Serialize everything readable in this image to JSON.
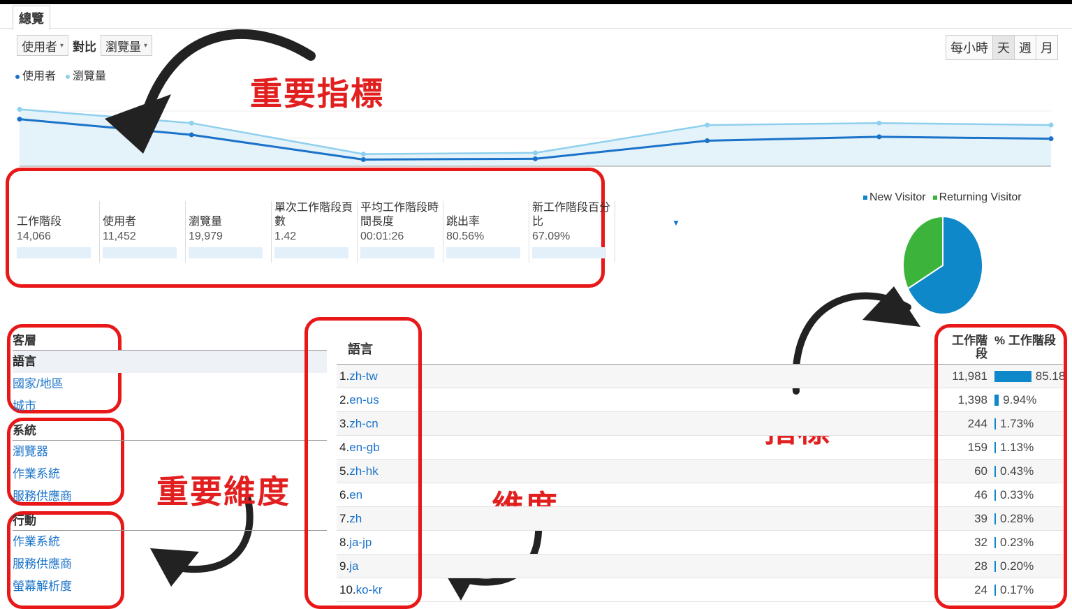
{
  "tab": "總覽",
  "controls": {
    "metric_a": "使用者",
    "versus": "對比",
    "metric_b": "瀏覽量"
  },
  "period": [
    "每小時",
    "天",
    "週",
    "月"
  ],
  "chart_legend": [
    {
      "label": "使用者",
      "color": "#1a73c9"
    },
    {
      "label": "瀏覽量",
      "color": "#8fd0ee"
    }
  ],
  "chart_data": {
    "type": "line",
    "x": [
      1,
      2,
      3,
      4,
      5,
      6,
      7
    ],
    "series": [
      {
        "name": "使用者",
        "values": [
          2400,
          1600,
          340,
          380,
          1300,
          1500,
          1400
        ]
      },
      {
        "name": "瀏覽量",
        "values": [
          2900,
          2200,
          620,
          680,
          2100,
          2200,
          2100
        ]
      }
    ],
    "ylim": [
      0,
      4200
    ]
  },
  "callouts": {
    "key_metrics": "重要指標",
    "key_dimensions": "重要維度",
    "dimensions": "維度",
    "metrics": "指標"
  },
  "metrics": [
    {
      "name": "工作階段",
      "value": "14,066"
    },
    {
      "name": "使用者",
      "value": "11,452"
    },
    {
      "name": "瀏覽量",
      "value": "19,979"
    },
    {
      "name": "單次工作階段頁數",
      "value": "1.42"
    },
    {
      "name": "平均工作階段時間長度",
      "value": "00:01:26"
    },
    {
      "name": "跳出率",
      "value": "80.56%"
    },
    {
      "name": "新工作階段百分比",
      "value": "67.09%"
    }
  ],
  "pie": {
    "legend": [
      {
        "label": "New Visitor",
        "color": "#0e88c9"
      },
      {
        "label": "Returning Visitor",
        "color": "#3cb43c"
      }
    ],
    "values": [
      67.1,
      32.9
    ]
  },
  "sidebar": {
    "groups": [
      {
        "title": "客層",
        "items": [
          "語言",
          "國家/地區",
          "城市"
        ]
      },
      {
        "title": "系統",
        "items": [
          "瀏覽器",
          "作業系統",
          "服務供應商"
        ]
      },
      {
        "title": "行動",
        "items": [
          "作業系統",
          "服務供應商",
          "螢幕解析度"
        ]
      }
    ]
  },
  "table": {
    "dimension_header": "語言",
    "sessions_header": "工作階段",
    "pct_header": "% 工作階段",
    "rows": [
      {
        "rank": "1.",
        "lang": "zh-tw",
        "sessions": "11,981",
        "pct": "85.18",
        "share": 85.18
      },
      {
        "rank": "2.",
        "lang": "en-us",
        "sessions": "1,398",
        "pct": "9.94%",
        "share": 9.94
      },
      {
        "rank": "3.",
        "lang": "zh-cn",
        "sessions": "244",
        "pct": "1.73%",
        "share": 1.73
      },
      {
        "rank": "4.",
        "lang": "en-gb",
        "sessions": "159",
        "pct": "1.13%",
        "share": 1.13
      },
      {
        "rank": "5.",
        "lang": "zh-hk",
        "sessions": "60",
        "pct": "0.43%",
        "share": 0.43
      },
      {
        "rank": "6.",
        "lang": "en",
        "sessions": "46",
        "pct": "0.33%",
        "share": 0.33
      },
      {
        "rank": "7.",
        "lang": "zh",
        "sessions": "39",
        "pct": "0.28%",
        "share": 0.28
      },
      {
        "rank": "8.",
        "lang": "ja-jp",
        "sessions": "32",
        "pct": "0.23%",
        "share": 0.23
      },
      {
        "rank": "9.",
        "lang": "ja",
        "sessions": "28",
        "pct": "0.20%",
        "share": 0.2
      },
      {
        "rank": "10.",
        "lang": "ko-kr",
        "sessions": "24",
        "pct": "0.17%",
        "share": 0.17
      }
    ]
  }
}
